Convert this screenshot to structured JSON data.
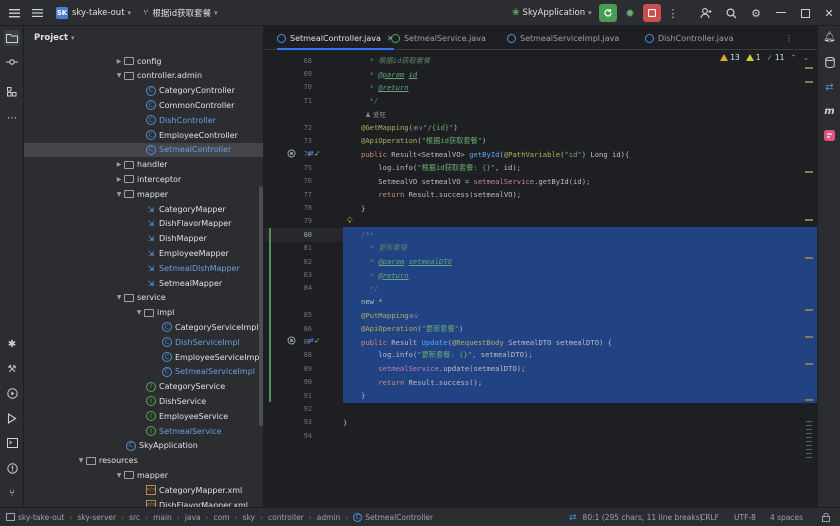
{
  "header": {
    "project_badge": "SK",
    "project_name": "sky-take-out",
    "branch": "根据id获取套餐",
    "run_config": "SkyApplication"
  },
  "project_panel": {
    "title": "Project",
    "tree": [
      {
        "label": "config",
        "kind": "folder",
        "indent": 2,
        "expand": "▶"
      },
      {
        "label": "controller.admin",
        "kind": "folder",
        "indent": 2,
        "expand": "▼"
      },
      {
        "label": "CategoryController",
        "kind": "class",
        "indent": 3,
        "color": "normal"
      },
      {
        "label": "CommonController",
        "kind": "class",
        "indent": 3,
        "color": "normal"
      },
      {
        "label": "DishController",
        "kind": "class",
        "indent": 3,
        "color": "blue"
      },
      {
        "label": "EmployeeController",
        "kind": "class",
        "indent": 3,
        "color": "normal"
      },
      {
        "label": "SetmealController",
        "kind": "class",
        "indent": 3,
        "color": "blue",
        "selected": true
      },
      {
        "label": "handler",
        "kind": "folder",
        "indent": 2,
        "expand": "▶"
      },
      {
        "label": "interceptor",
        "kind": "folder",
        "indent": 2,
        "expand": "▶"
      },
      {
        "label": "mapper",
        "kind": "folder",
        "indent": 2,
        "expand": "▼"
      },
      {
        "label": "CategoryMapper",
        "kind": "mapper",
        "indent": 3,
        "color": "normal"
      },
      {
        "label": "DishFlavorMapper",
        "kind": "mapper",
        "indent": 3,
        "color": "normal"
      },
      {
        "label": "DishMapper",
        "kind": "mapper",
        "indent": 3,
        "color": "normal"
      },
      {
        "label": "EmployeeMapper",
        "kind": "mapper",
        "indent": 3,
        "color": "normal"
      },
      {
        "label": "SetmealDishMapper",
        "kind": "mapper",
        "indent": 3,
        "color": "blue"
      },
      {
        "label": "SetmealMapper",
        "kind": "mapper",
        "indent": 3,
        "color": "normal"
      },
      {
        "label": "service",
        "kind": "folder",
        "indent": 2,
        "expand": "▼"
      },
      {
        "label": "impl",
        "kind": "folder",
        "indent": 3,
        "expand": "▼"
      },
      {
        "label": "CategoryServiceImpl",
        "kind": "class",
        "indent": 4,
        "color": "normal"
      },
      {
        "label": "DishServiceImpl",
        "kind": "class",
        "indent": 4,
        "color": "blue"
      },
      {
        "label": "EmployeeServiceImpl",
        "kind": "class",
        "indent": 4,
        "color": "normal"
      },
      {
        "label": "SetmealServiceImpl",
        "kind": "class",
        "indent": 4,
        "color": "blue"
      },
      {
        "label": "CategoryService",
        "kind": "iface",
        "indent": 3,
        "color": "normal"
      },
      {
        "label": "DishService",
        "kind": "iface",
        "indent": 3,
        "color": "normal"
      },
      {
        "label": "EmployeeService",
        "kind": "iface",
        "indent": 3,
        "color": "normal"
      },
      {
        "label": "SetmealService",
        "kind": "iface",
        "indent": 3,
        "color": "blue"
      },
      {
        "label": "SkyApplication",
        "kind": "class",
        "indent": 2,
        "color": "normal"
      },
      {
        "label": "resources",
        "kind": "folder",
        "indent": 1,
        "expand": "▼"
      },
      {
        "label": "mapper",
        "kind": "folder",
        "indent": 2,
        "expand": "▼"
      },
      {
        "label": "CategoryMapper.xml",
        "kind": "xml",
        "indent": 3,
        "color": "normal"
      },
      {
        "label": "DishFlavorMapper.xml",
        "kind": "xml",
        "indent": 3,
        "color": "normal"
      }
    ]
  },
  "tabs": [
    {
      "label": "SetmealController.java",
      "active": true,
      "iface": false
    },
    {
      "label": "SetmealService.java",
      "active": false,
      "iface": true
    },
    {
      "label": "SetmealServiceImpl.java",
      "active": false,
      "iface": false
    },
    {
      "label": "DishController.java",
      "active": false,
      "iface": false
    }
  ],
  "inspections": {
    "warnings": "13",
    "weak_warnings": "1",
    "typos": "11"
  },
  "code_lines": [
    {
      "n": "68",
      "segs": [
        [
          "c-doc",
          "  * 根据id获取套餐"
        ]
      ]
    },
    {
      "n": "69",
      "segs": [
        [
          "c-doc",
          "  * "
        ],
        [
          "c-tag",
          "@param"
        ],
        [
          "c-doc",
          " "
        ],
        [
          "c-tag",
          "id"
        ]
      ]
    },
    {
      "n": "70",
      "segs": [
        [
          "c-doc",
          "  * "
        ],
        [
          "c-tag",
          "@return"
        ]
      ]
    },
    {
      "n": "71",
      "segs": [
        [
          "c-doc",
          "  */"
        ]
      ]
    },
    {
      "n": "",
      "segs": [
        [
          "c-hint",
          "  ♟ 爱旺"
        ]
      ]
    },
    {
      "n": "72",
      "segs": [
        [
          "c-ann",
          "@GetMapping"
        ],
        [
          "c-df",
          "("
        ],
        [
          "c-hint",
          "⊕∨"
        ],
        [
          "c-str",
          "\"/{id}\""
        ],
        [
          "c-df",
          ")"
        ]
      ]
    },
    {
      "n": "73",
      "segs": [
        [
          "c-ann",
          "@ApiOperation"
        ],
        [
          "c-df",
          "("
        ],
        [
          "c-str",
          "\"根据id获取套餐\""
        ],
        [
          "c-df",
          ")"
        ]
      ]
    },
    {
      "n": "74",
      "segs": [
        [
          "c-kw",
          "public "
        ],
        [
          "c-df",
          "Result<SetmealVO> "
        ],
        [
          "c-fn",
          "getById"
        ],
        [
          "c-df",
          "("
        ],
        [
          "c-ann",
          "@PathVariable"
        ],
        [
          "c-df",
          "("
        ],
        [
          "c-str",
          "\"id\""
        ],
        [
          "c-df",
          ") Long id){"
        ]
      ]
    },
    {
      "n": "75",
      "segs": [
        [
          "c-df",
          "    log.info("
        ],
        [
          "c-str",
          "\"根据id获取套餐: {}\""
        ],
        [
          "c-df",
          ", id);"
        ]
      ]
    },
    {
      "n": "76",
      "segs": [
        [
          "c-df",
          "    SetmealVO setmealVO = "
        ],
        [
          "c-fld",
          "setmealService"
        ],
        [
          "c-df",
          ".getById(id);"
        ]
      ]
    },
    {
      "n": "77",
      "segs": [
        [
          "c-kw",
          "    return "
        ],
        [
          "c-df",
          "Result."
        ],
        [
          "c-df",
          "success(setmealVO);"
        ]
      ]
    },
    {
      "n": "78",
      "segs": [
        [
          "c-df",
          "}"
        ]
      ]
    },
    {
      "n": "79",
      "segs": []
    },
    {
      "n": "80",
      "segs": [
        [
          "c-doc",
          "/**"
        ]
      ],
      "cur": true
    },
    {
      "n": "81",
      "segs": [
        [
          "c-doc",
          "  * 更新套餐"
        ]
      ]
    },
    {
      "n": "82",
      "segs": [
        [
          "c-doc",
          "  * "
        ],
        [
          "c-tag",
          "@param"
        ],
        [
          "c-doc",
          " "
        ],
        [
          "c-tag",
          "setmealDTO"
        ]
      ]
    },
    {
      "n": "83",
      "segs": [
        [
          "c-doc",
          "  * "
        ],
        [
          "c-tag",
          "@return"
        ]
      ]
    },
    {
      "n": "84",
      "segs": [
        [
          "c-doc",
          "  */"
        ]
      ]
    },
    {
      "n": "",
      "segs": [
        [
          "c-df",
          "new *"
        ]
      ]
    },
    {
      "n": "85",
      "segs": [
        [
          "c-ann",
          "@PutMapping"
        ],
        [
          "c-hint",
          "⊕∨"
        ]
      ]
    },
    {
      "n": "86",
      "segs": [
        [
          "c-ann",
          "@ApiOperation"
        ],
        [
          "c-df",
          "("
        ],
        [
          "c-str",
          "\"更新套餐\""
        ],
        [
          "c-df",
          ")"
        ]
      ]
    },
    {
      "n": "87",
      "segs": [
        [
          "c-kw",
          "public "
        ],
        [
          "c-df",
          "Result "
        ],
        [
          "c-fn",
          "Update"
        ],
        [
          "c-df",
          "("
        ],
        [
          "c-ann",
          "@RequestBody"
        ],
        [
          "c-df",
          " SetmealDTO setmealDTO) {"
        ]
      ]
    },
    {
      "n": "88",
      "segs": [
        [
          "c-df",
          "    log.info("
        ],
        [
          "c-str",
          "\"更新套餐: {}\""
        ],
        [
          "c-df",
          ", setmealDTO);"
        ]
      ]
    },
    {
      "n": "89",
      "segs": [
        [
          "c-fld",
          "    setmealService"
        ],
        [
          "c-df",
          ".update(setmealDTO);"
        ]
      ]
    },
    {
      "n": "90",
      "segs": [
        [
          "c-kw",
          "    return "
        ],
        [
          "c-df",
          "Result.success();"
        ]
      ]
    },
    {
      "n": "91",
      "segs": [
        [
          "c-df",
          "}"
        ]
      ]
    },
    {
      "n": "92",
      "segs": []
    },
    {
      "n": "93",
      "segs": [
        [
          "c-df",
          "}"
        ]
      ]
    },
    {
      "n": "94",
      "segs": []
    }
  ],
  "status": {
    "crumbs": [
      "sky-take-out",
      "sky-server",
      "src",
      "main",
      "java",
      "com",
      "sky",
      "controller",
      "admin",
      "SetmealController"
    ],
    "selection": "80:1 (295 chars, 11 line breaks)",
    "line_sep": "CRLF",
    "encoding": "UTF-8",
    "indent": "4 spaces"
  },
  "colors": {
    "accent": "#3574f0",
    "selection": "#214283",
    "run_green": "#499c54",
    "stop_red": "#c94f4f"
  }
}
